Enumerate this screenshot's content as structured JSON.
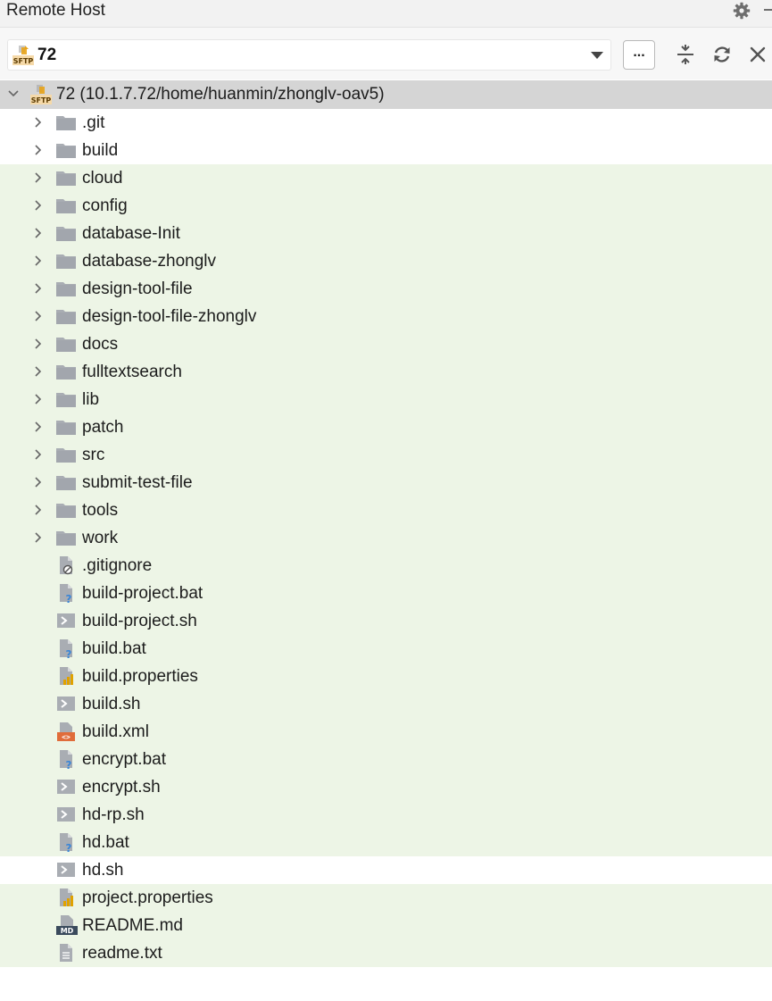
{
  "panel": {
    "title": "Remote Host",
    "icons": {
      "settings": "gear-icon",
      "more": "minus-icon"
    }
  },
  "toolbar": {
    "host_value": "72",
    "browse_label": "...",
    "icons": [
      "sftp-icon",
      "chevron-down-icon",
      "collapse-all-icon",
      "refresh-icon",
      "close-icon"
    ]
  },
  "tree": {
    "root": {
      "label": "72 (10.1.7.72/home/huanmin/zhonglv-oav5)",
      "expanded": true,
      "icon": "sftp-icon"
    },
    "folders": [
      {
        "label": ".git"
      },
      {
        "label": "build"
      },
      {
        "label": "cloud"
      },
      {
        "label": "config"
      },
      {
        "label": "database-Init"
      },
      {
        "label": "database-zhonglv"
      },
      {
        "label": "design-tool-file"
      },
      {
        "label": "design-tool-file-zhonglv"
      },
      {
        "label": "docs"
      },
      {
        "label": "fulltextsearch"
      },
      {
        "label": "lib"
      },
      {
        "label": "patch"
      },
      {
        "label": "src"
      },
      {
        "label": "submit-test-file"
      },
      {
        "label": "tools"
      },
      {
        "label": "work"
      }
    ],
    "files": [
      {
        "label": ".gitignore",
        "icon": "ignore-file-icon"
      },
      {
        "label": "build-project.bat",
        "icon": "unknown-file-icon"
      },
      {
        "label": "build-project.sh",
        "icon": "shell-file-icon"
      },
      {
        "label": "build.bat",
        "icon": "unknown-file-icon"
      },
      {
        "label": "build.properties",
        "icon": "properties-file-icon"
      },
      {
        "label": "build.sh",
        "icon": "shell-file-icon"
      },
      {
        "label": "build.xml",
        "icon": "xml-file-icon"
      },
      {
        "label": "encrypt.bat",
        "icon": "unknown-file-icon"
      },
      {
        "label": "encrypt.sh",
        "icon": "shell-file-icon"
      },
      {
        "label": "hd-rp.sh",
        "icon": "shell-file-icon"
      },
      {
        "label": "hd.bat",
        "icon": "unknown-file-icon"
      },
      {
        "label": "hd.sh",
        "icon": "shell-file-icon"
      },
      {
        "label": "project.properties",
        "icon": "properties-file-icon"
      },
      {
        "label": "README.md",
        "icon": "markdown-file-icon"
      },
      {
        "label": "readme.txt",
        "icon": "text-file-icon"
      }
    ]
  },
  "colors": {
    "root_row": "#d5d5d5",
    "modified_row": "#edf5e6",
    "folder": "#a9adb3",
    "sftp_accent": "#e8a317",
    "xml_accent": "#e06c3a",
    "unknown_accent": "#3b86d6",
    "properties_accent": "#e0a200"
  }
}
